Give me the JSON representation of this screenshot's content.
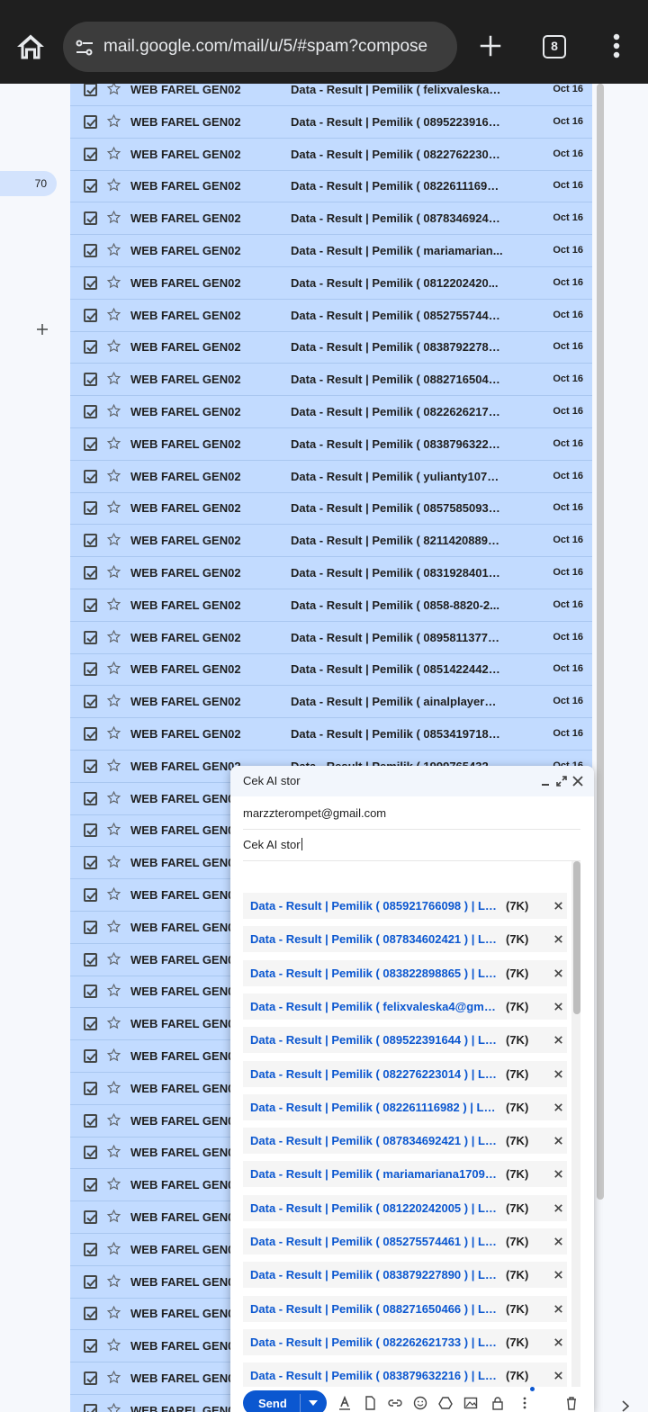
{
  "browser": {
    "url": "mail.google.com/mail/u/5/#spam?compose",
    "tab_count": "8"
  },
  "sidebar": {
    "count": "70"
  },
  "mail_list": {
    "sender": "WEB FAREL GEN02",
    "rows": [
      {
        "subject": "Data - Result | Pemilik ( felixvaleska4...",
        "date": "Oct 16"
      },
      {
        "subject": "Data - Result | Pemilik ( 08952239164...",
        "date": "Oct 16"
      },
      {
        "subject": "Data - Result | Pemilik ( 08227622301...",
        "date": "Oct 16"
      },
      {
        "subject": "Data - Result | Pemilik ( 082261116982...",
        "date": "Oct 16"
      },
      {
        "subject": "Data - Result | Pemilik ( 08783469242...",
        "date": "Oct 16"
      },
      {
        "subject": "Data - Result | Pemilik ( mariamarian...",
        "date": "Oct 16"
      },
      {
        "subject": "Data - Result | Pemilik ( 0812202420...",
        "date": "Oct 16"
      },
      {
        "subject": "Data - Result | Pemilik ( 08527557446...",
        "date": "Oct 16"
      },
      {
        "subject": "Data - Result | Pemilik ( 08387922789...",
        "date": "Oct 16"
      },
      {
        "subject": "Data - Result | Pemilik ( 08827165046...",
        "date": "Oct 16"
      },
      {
        "subject": "Data - Result | Pemilik ( 08226262173...",
        "date": "Oct 16"
      },
      {
        "subject": "Data - Result | Pemilik ( 08387963221...",
        "date": "Oct 16"
      },
      {
        "subject": "Data - Result | Pemilik ( yulianty1071...",
        "date": "Oct 16"
      },
      {
        "subject": "Data - Result | Pemilik ( 08575850936...",
        "date": "Oct 16"
      },
      {
        "subject": "Data - Result | Pemilik ( 82114208893 ...",
        "date": "Oct 16"
      },
      {
        "subject": "Data - Result | Pemilik ( 08319284019...",
        "date": "Oct 16"
      },
      {
        "subject": "Data - Result | Pemilik ( 0858-8820-2...",
        "date": "Oct 16"
      },
      {
        "subject": "Data - Result | Pemilik ( 08958113775...",
        "date": "Oct 16"
      },
      {
        "subject": "Data - Result | Pemilik ( 08514224429...",
        "date": "Oct 16"
      },
      {
        "subject": "Data - Result | Pemilik ( ainalplayer@...",
        "date": "Oct 16"
      },
      {
        "subject": "Data - Result | Pemilik ( 08534197184...",
        "date": "Oct 16"
      },
      {
        "subject": "Data - Result | Pemilik ( 19997654321...",
        "date": "Oct 16"
      },
      {
        "subject": "",
        "date": ""
      },
      {
        "subject": "",
        "date": ""
      },
      {
        "subject": "",
        "date": ""
      },
      {
        "subject": "",
        "date": ""
      },
      {
        "subject": "",
        "date": ""
      },
      {
        "subject": "",
        "date": ""
      },
      {
        "subject": "",
        "date": ""
      },
      {
        "subject": "",
        "date": ""
      },
      {
        "subject": "",
        "date": ""
      },
      {
        "subject": "",
        "date": ""
      },
      {
        "subject": "",
        "date": ""
      },
      {
        "subject": "",
        "date": ""
      },
      {
        "subject": "",
        "date": ""
      },
      {
        "subject": "",
        "date": ""
      },
      {
        "subject": "",
        "date": ""
      },
      {
        "subject": "",
        "date": ""
      },
      {
        "subject": "",
        "date": ""
      },
      {
        "subject": "",
        "date": ""
      },
      {
        "subject": "",
        "date": ""
      },
      {
        "subject": "",
        "date": ""
      },
      {
        "subject": "",
        "date": ""
      }
    ]
  },
  "compose": {
    "title": "Cek AI stor",
    "to": "marzzterompet@gmail.com",
    "subject": "Cek AI stor",
    "send_label": "Send",
    "attachments": [
      {
        "name": "Data - Result | Pemilik ( 085921766098 ) | Lo...",
        "size": "(7K)"
      },
      {
        "name": "Data - Result | Pemilik ( 087834602421 ) | Lo...",
        "size": "(7K)"
      },
      {
        "name": "Data - Result | Pemilik ( 083822898865 ) | Lo...",
        "size": "(7K)"
      },
      {
        "name": "Data - Result | Pemilik ( felixvaleska4@gmail...",
        "size": "(7K)"
      },
      {
        "name": "Data - Result | Pemilik ( 089522391644 ) | Lo...",
        "size": "(7K)"
      },
      {
        "name": "Data - Result | Pemilik ( 082276223014 ) | Lo...",
        "size": "(7K)"
      },
      {
        "name": "Data - Result | Pemilik ( 082261116982 ) | Log...",
        "size": "(7K)"
      },
      {
        "name": "Data - Result | Pemilik ( 087834692421 ) | Lo...",
        "size": "(7K)"
      },
      {
        "name": "Data - Result | Pemilik ( mariamariana17092...",
        "size": "(7K)"
      },
      {
        "name": "Data - Result | Pemilik ( 081220242005 ) | Lo...",
        "size": "(7K)"
      },
      {
        "name": "Data - Result | Pemilik ( 085275574461 ) | Lo...",
        "size": "(7K)"
      },
      {
        "name": "Data - Result | Pemilik ( 083879227890 ) | Lo...",
        "size": "(7K)"
      },
      {
        "name": "Data - Result | Pemilik ( 088271650466 ) | Lo...",
        "size": "(7K)"
      },
      {
        "name": "Data - Result | Pemilik ( 082262621733 ) | Lo...",
        "size": "(7K)"
      },
      {
        "name": "Data - Result | Pemilik ( 083879632216 ) | Lo...",
        "size": "(7K)"
      }
    ]
  },
  "colors": {
    "selected_row": "#c2dbff",
    "accent": "#0b57d0",
    "browser_bar": "#1f1f1f"
  }
}
